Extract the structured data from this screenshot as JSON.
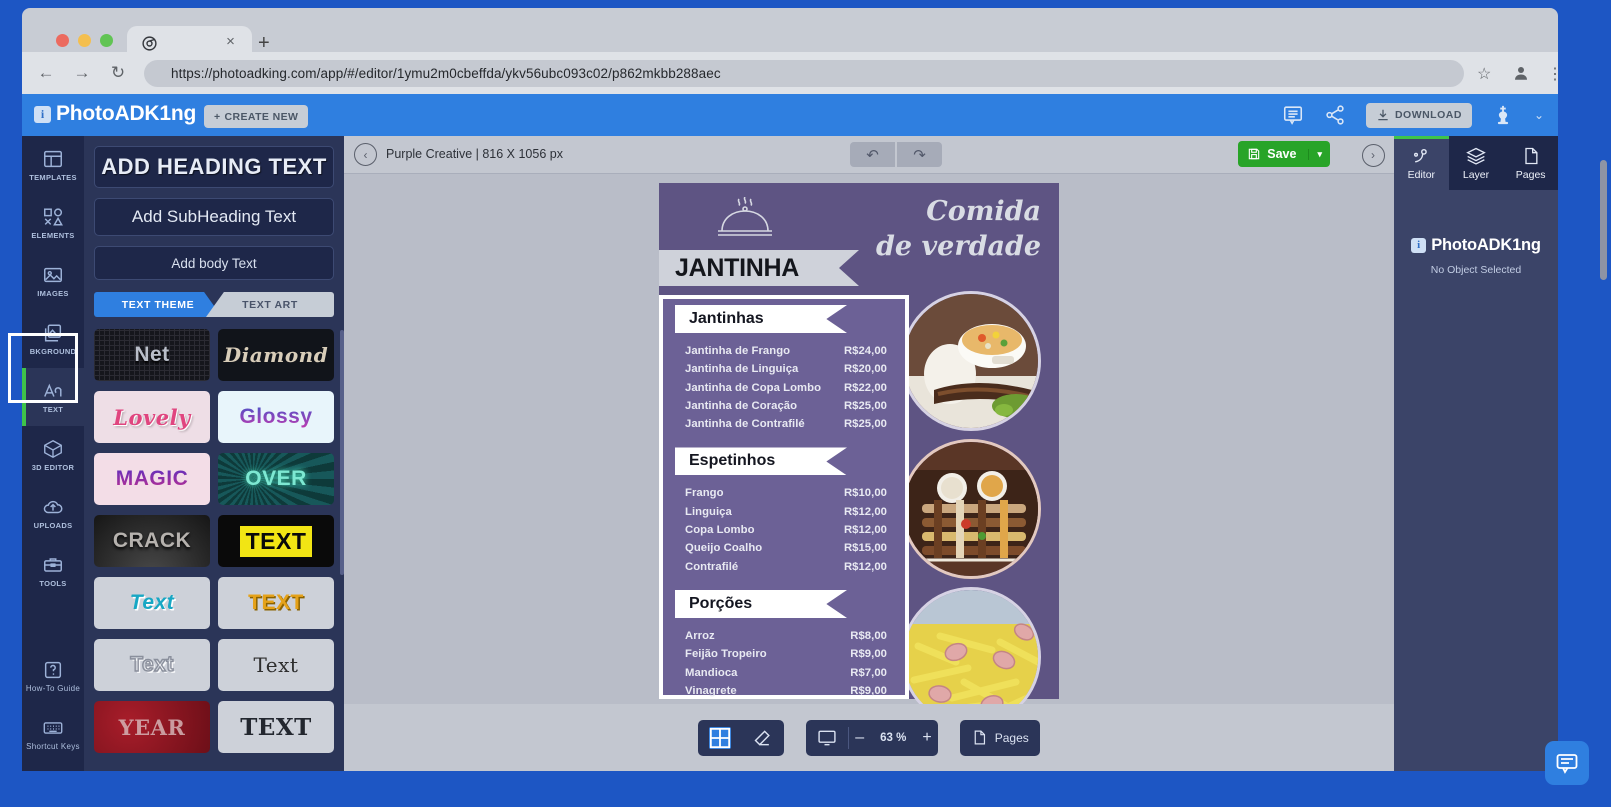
{
  "browser": {
    "url": "https://photoadking.com/app/#/editor/1ymu2m0cbeffda/ykv56ubc093c02/p862mkbb288aec",
    "tab_title": "",
    "back_icon": "back-arrow-icon",
    "forward_icon": "forward-arrow-icon",
    "reload_icon": "reload-icon",
    "star_icon": "bookmark-star-icon",
    "profile_icon": "profile-avatar-icon",
    "menu_icon": "kebab-menu-icon",
    "new_tab_label": "+",
    "close_tab_label": "×"
  },
  "header": {
    "brand_mark": "i",
    "brand_name": "PhotoADK1ng",
    "create_new_label": "CREATE NEW",
    "create_new_plus": "+",
    "download_label": "DOWNLOAD",
    "comment_icon": "comment-icon",
    "share_icon": "share-icon",
    "download_icon": "download-icon",
    "king_icon": "king-chess-piece-icon",
    "chevron": "⌄",
    "accent_color": "#2f7fe0"
  },
  "sidebar": {
    "items": [
      {
        "label": "TEMPLATES",
        "icon": "templates-icon",
        "active": false
      },
      {
        "label": "ELEMENTS",
        "icon": "elements-icon",
        "active": false
      },
      {
        "label": "IMAGES",
        "icon": "images-icon",
        "active": false
      },
      {
        "label": "BKGROUND",
        "icon": "background-icon",
        "active": false
      },
      {
        "label": "TEXT",
        "icon": "text-icon",
        "active": true
      },
      {
        "label": "3D EDITOR",
        "icon": "3d-editor-icon",
        "active": false
      },
      {
        "label": "UPLOADS",
        "icon": "uploads-icon",
        "active": false
      },
      {
        "label": "TOOLS",
        "icon": "tools-icon",
        "active": false
      }
    ],
    "bottom_items": [
      {
        "label": "How-To Guide",
        "icon": "question-mark-icon"
      },
      {
        "label": "Shortcut Keys",
        "icon": "keyboard-icon"
      }
    ],
    "active_highlight_color": "#3fc44a"
  },
  "text_panel": {
    "add_heading_label": "ADD HEADING TEXT",
    "add_subheading_label": "Add SubHeading Text",
    "add_body_label": "Add body Text",
    "tabs": [
      {
        "label": "TEXT THEME",
        "selected": true
      },
      {
        "label": "TEXT ART",
        "selected": false
      }
    ],
    "thumbnails": [
      {
        "label": "Net",
        "bg": "#15161c",
        "color": "#b9bec9",
        "style": "net"
      },
      {
        "label": "Diamond",
        "bg": "#11141a",
        "color": "#d8cdb9",
        "style": "diamond"
      },
      {
        "label": "Lovely",
        "bg": "#eedee6",
        "color": "#e0457f",
        "style": "lovely"
      },
      {
        "label": "Glossy",
        "bg": "#e8f5fb",
        "color": "#6f3fc6",
        "style": "glossy"
      },
      {
        "label": "MAGIC",
        "bg": "#f3dde7",
        "color": "#8d2fa8",
        "style": "magic"
      },
      {
        "label": "OVER",
        "bg": "#0e3a3a",
        "color": "#7de8d2",
        "style": "over"
      },
      {
        "label": "CRACK",
        "bg": "#2a2a2a",
        "color": "#b6b2ae",
        "style": "crack"
      },
      {
        "label": "TEXT",
        "bg": "#0a0a0a",
        "color": "#f2e514",
        "style": "yellowbox"
      },
      {
        "label": "Text",
        "bg": "#cdd1d9",
        "color": "#17a7c4",
        "style": "cyan"
      },
      {
        "label": "TEXT",
        "bg": "#cdd1d9",
        "color": "#e5a21a",
        "style": "gold"
      },
      {
        "label": "Text",
        "bg": "#cdd1d9",
        "color": "#c8ccd4",
        "style": "outline"
      },
      {
        "label": "Text",
        "bg": "#cdd1d9",
        "color": "#2e2e2e",
        "style": "serif"
      },
      {
        "label": "YEAR",
        "bg": "#8c1622",
        "color": "#d8b9bb",
        "style": "red"
      },
      {
        "label": "TEXT",
        "bg": "#cdd1d9",
        "color": "#23272f",
        "style": "slab"
      }
    ]
  },
  "editor_bar": {
    "back_icon": "chevron-left-circle-icon",
    "doc_title": "Purple Creative | 816 X 1056 px",
    "undo_icon": "undo-icon",
    "redo_icon": "redo-icon",
    "save_label": "Save",
    "save_icon": "floppy-disk-icon",
    "save_caret": "▾",
    "save_color": "#28a428",
    "expand_icon": "chevron-right-circle-icon"
  },
  "poster": {
    "brand_title": "JANTINHA",
    "tagline_line1": "Comida",
    "tagline_line2": "de verdade",
    "dome_icon": "cloche-dome-icon",
    "bg_color": "#5e5483",
    "card_bg_color": "#6c6196",
    "sections": [
      {
        "title": "Jantinhas",
        "items": [
          {
            "name": "Jantinha de Frango",
            "price": "R$24,00"
          },
          {
            "name": "Jantinha de Linguiça",
            "price": "R$20,00"
          },
          {
            "name": "Jantinha de Copa Lombo",
            "price": "R$22,00"
          },
          {
            "name": "Jantinha de Coração",
            "price": "R$25,00"
          },
          {
            "name": "Jantinha de Contrafilé",
            "price": "R$25,00"
          }
        ]
      },
      {
        "title": "Espetinhos",
        "items": [
          {
            "name": "Frango",
            "price": "R$10,00"
          },
          {
            "name": "Linguiça",
            "price": "R$12,00"
          },
          {
            "name": "Copa Lombo",
            "price": "R$12,00"
          },
          {
            "name": "Queijo Coalho",
            "price": "R$15,00"
          },
          {
            "name": "Contrafilé",
            "price": "R$12,00"
          }
        ]
      },
      {
        "title": "Porções",
        "items": [
          {
            "name": "Arroz",
            "price": "R$8,00"
          },
          {
            "name": "Feijão Tropeiro",
            "price": "R$9,00"
          },
          {
            "name": "Mandioca",
            "price": "R$7,00"
          },
          {
            "name": "Vinagrete",
            "price": "R$9,00"
          }
        ]
      }
    ],
    "photos": [
      {
        "name": "soup-rice-meat-photo"
      },
      {
        "name": "skewers-platter-photo"
      },
      {
        "name": "fries-sausage-photo"
      }
    ]
  },
  "bottom_bar": {
    "grid_icon": "grid-toggle-icon",
    "eraser_icon": "eraser-icon",
    "screen_icon": "fit-screen-icon",
    "zoom_out": "–",
    "zoom_value": "63 %",
    "zoom_in": "+",
    "pages_label": "Pages",
    "pages_icon": "page-icon"
  },
  "right_panel": {
    "tabs": [
      {
        "label": "Editor",
        "icon": "editor-node-icon",
        "selected": true
      },
      {
        "label": "Layer",
        "icon": "layers-icon",
        "selected": false
      },
      {
        "label": "Pages",
        "icon": "page-icon",
        "selected": false
      }
    ],
    "brand_mark": "i",
    "brand_name": "PhotoADK1ng",
    "empty_state": "No Object Selected",
    "chat_icon": "chat-bubble-icon"
  }
}
